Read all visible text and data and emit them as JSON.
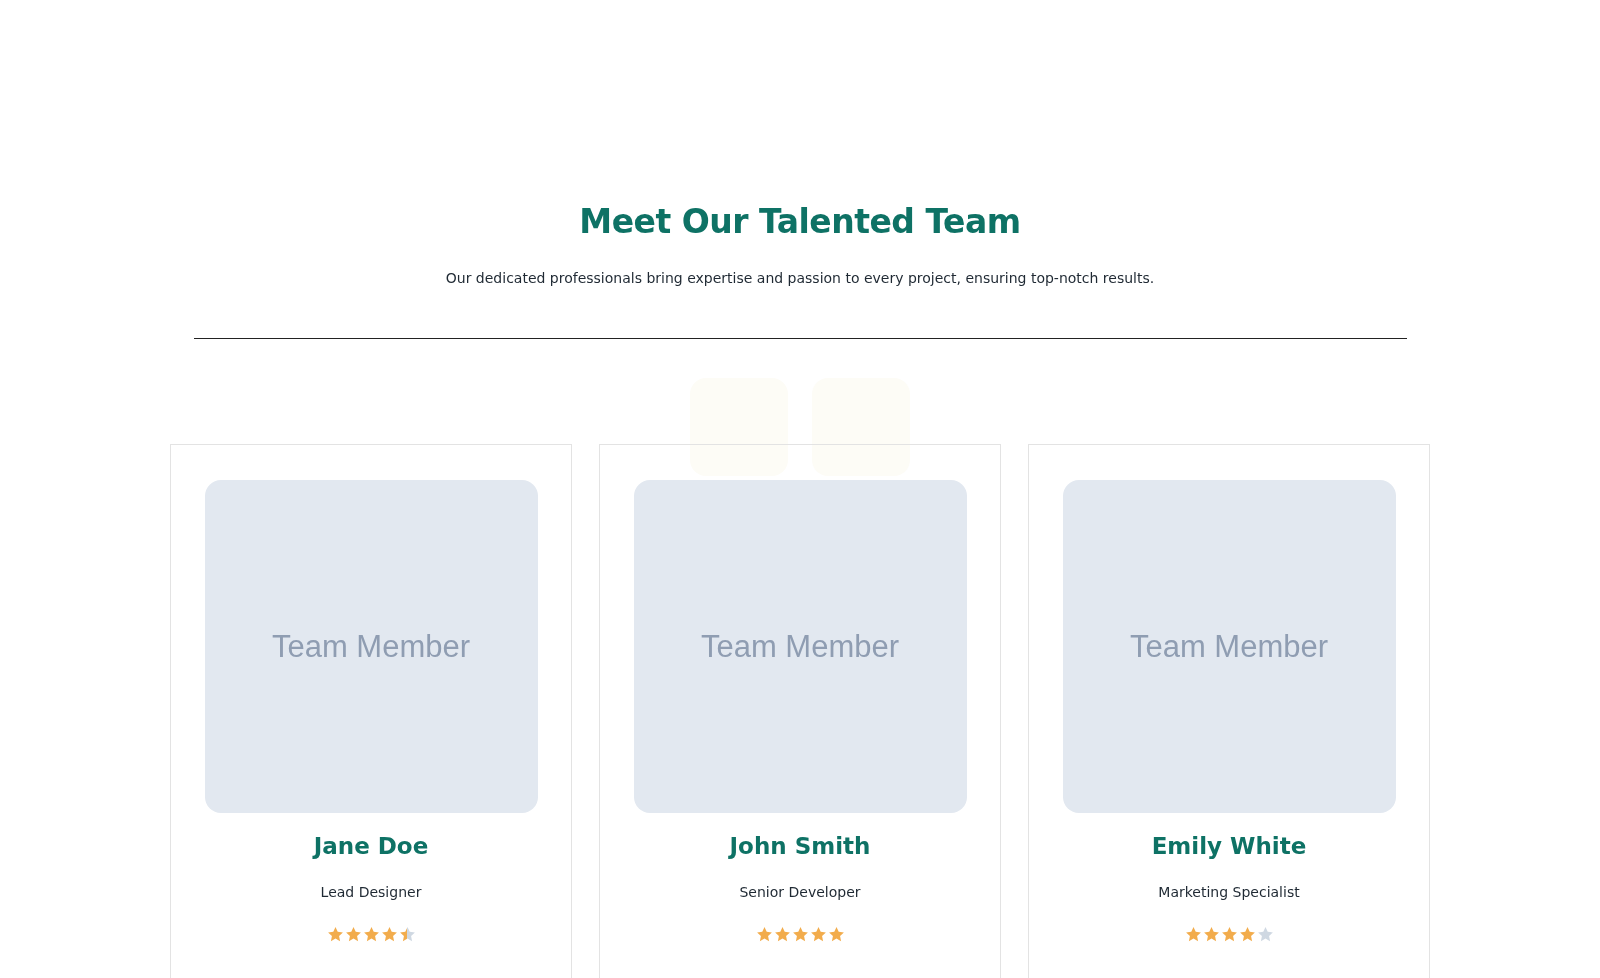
{
  "header": {
    "title": "Meet Our Talented Team",
    "subtitle": "Our dedicated professionals bring expertise and passion to every project, ensuring top-notch results."
  },
  "members": [
    {
      "photo_label": "Team Member",
      "name": "Jane Doe",
      "role": "Lead Designer",
      "stars": 4.5
    },
    {
      "photo_label": "Team Member",
      "name": "John Smith",
      "role": "Senior Developer",
      "stars": 5
    },
    {
      "photo_label": "Team Member",
      "name": "Emily White",
      "role": "Marketing Specialist",
      "stars": 4
    }
  ]
}
